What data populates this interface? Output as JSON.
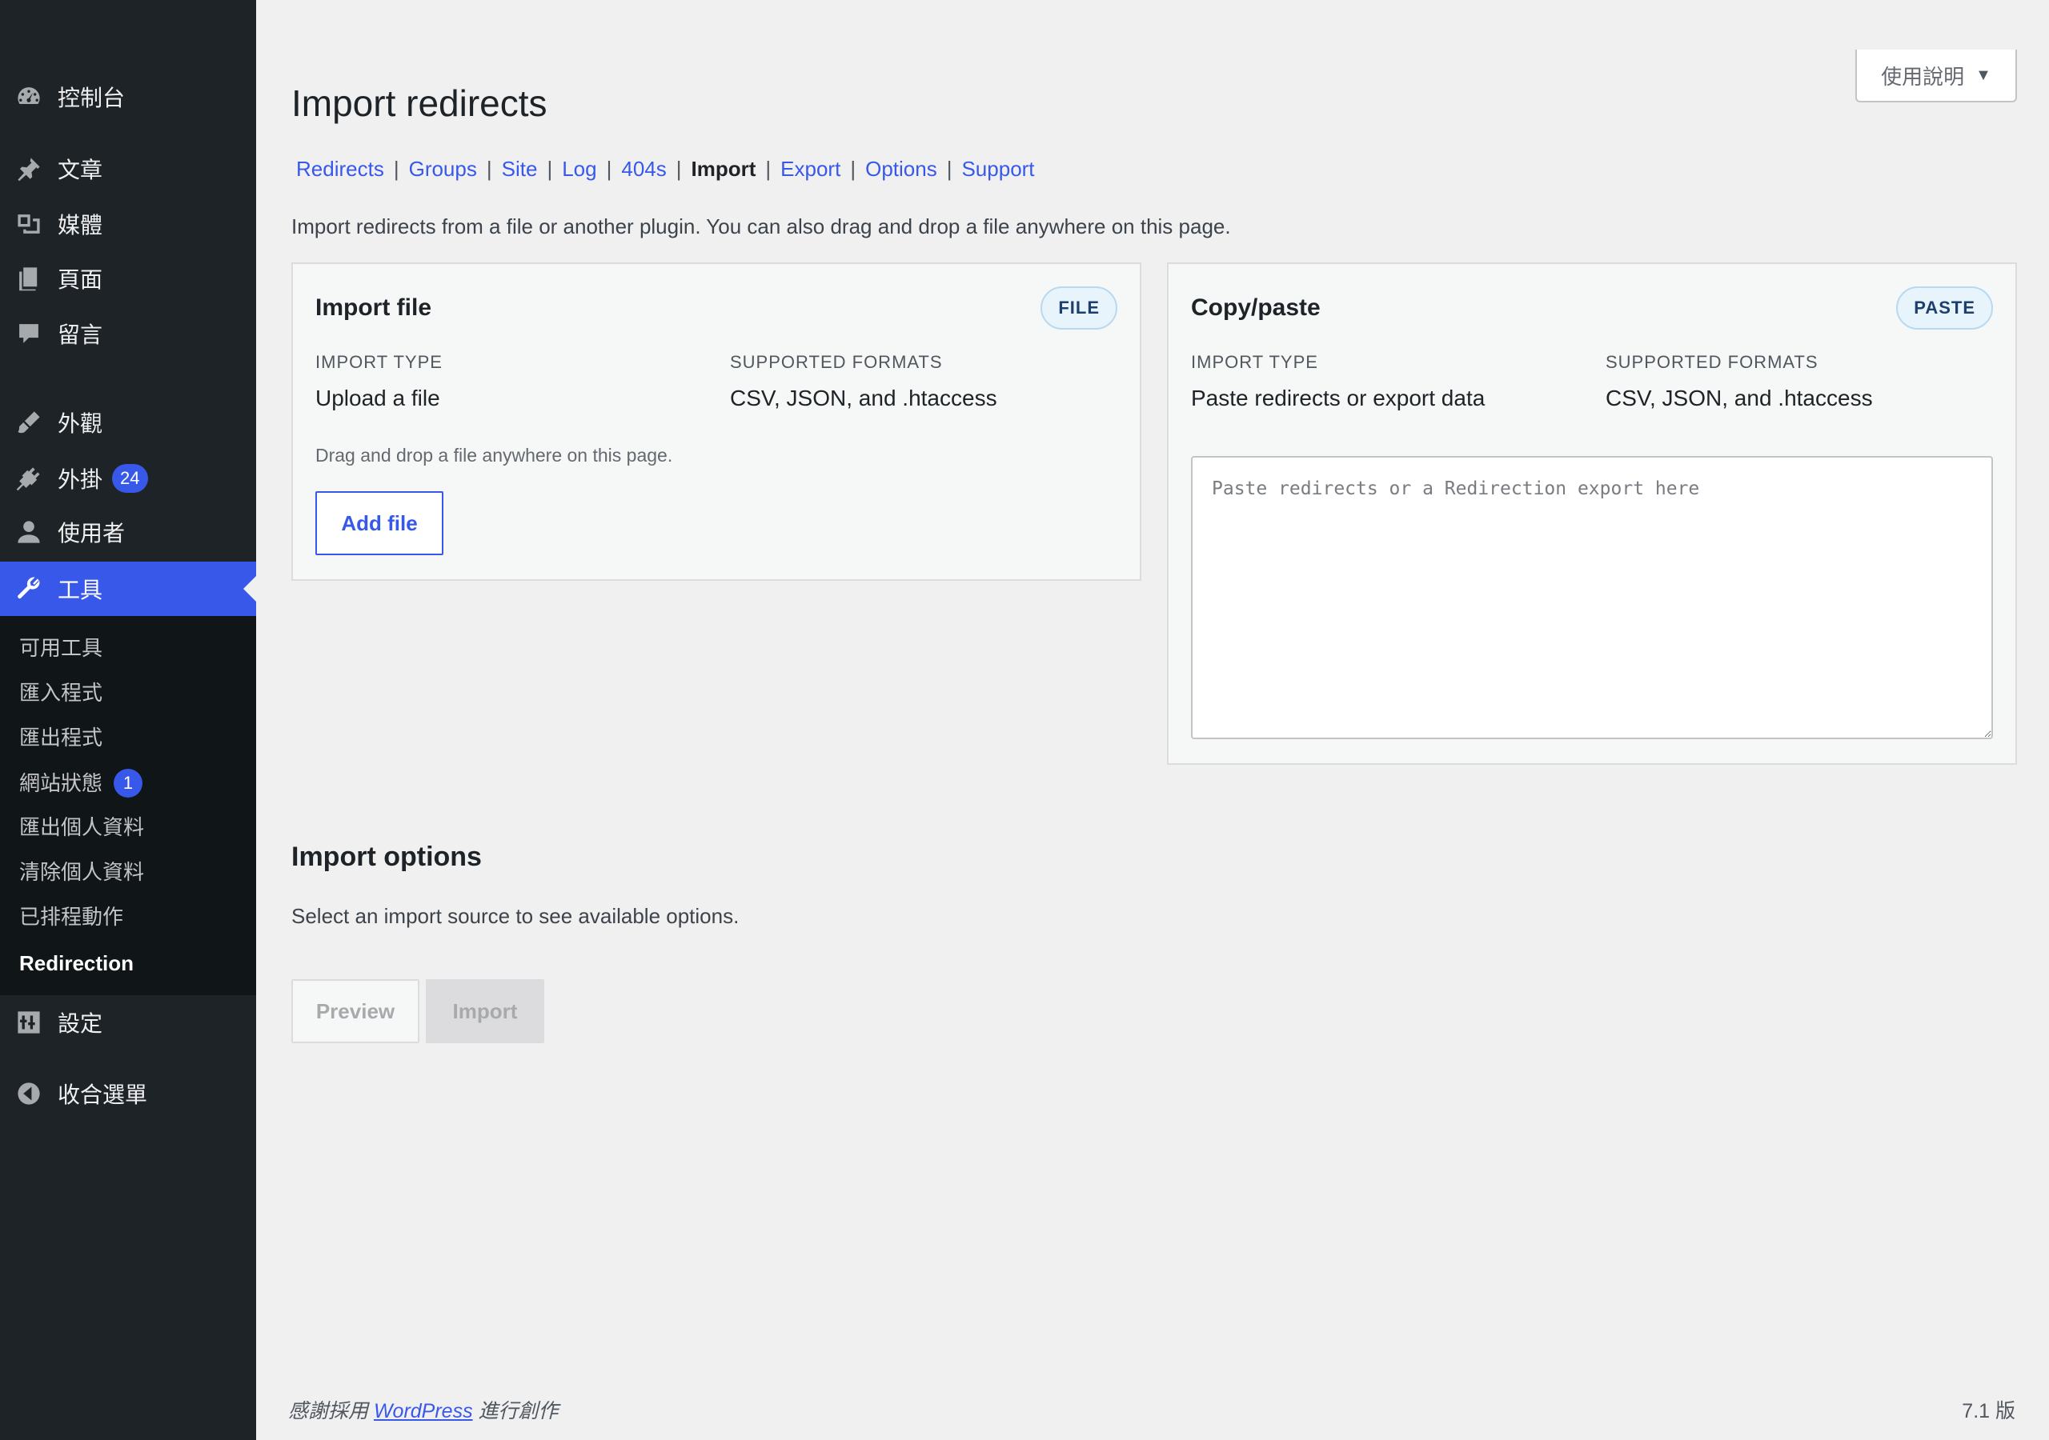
{
  "sidebar": {
    "items": [
      {
        "label": "控制台",
        "icon": "dashboard-icon"
      },
      {
        "label": "文章",
        "icon": "pin-icon"
      },
      {
        "label": "媒體",
        "icon": "media-icon"
      },
      {
        "label": "頁面",
        "icon": "pages-icon"
      },
      {
        "label": "留言",
        "icon": "comment-icon"
      },
      {
        "label": "外觀",
        "icon": "brush-icon"
      },
      {
        "label": "外掛",
        "icon": "plugin-icon",
        "badge": "24"
      },
      {
        "label": "使用者",
        "icon": "user-icon"
      },
      {
        "label": "工具",
        "icon": "wrench-icon"
      },
      {
        "label": "設定",
        "icon": "settings-icon"
      },
      {
        "label": "收合選單",
        "icon": "collapse-icon"
      }
    ],
    "active": "工具",
    "submenu": [
      {
        "label": "可用工具"
      },
      {
        "label": "匯入程式"
      },
      {
        "label": "匯出程式"
      },
      {
        "label": "網站狀態",
        "badge": "1"
      },
      {
        "label": "匯出個人資料"
      },
      {
        "label": "清除個人資料"
      },
      {
        "label": "已排程動作"
      },
      {
        "label": "Redirection"
      }
    ],
    "current_submenu": "Redirection"
  },
  "help_tab": {
    "label": "使用說明",
    "caret": "▼"
  },
  "page": {
    "title": "Import redirects",
    "nav": [
      "Redirects",
      "Groups",
      "Site",
      "Log",
      "404s",
      "Import",
      "Export",
      "Options",
      "Support"
    ],
    "nav_current": "Import",
    "intro": "Import redirects from a file or another plugin. You can also drag and drop a file anywhere on this page."
  },
  "import_file_card": {
    "title": "Import file",
    "badge": "FILE",
    "type_label": "IMPORT TYPE",
    "type_value": "Upload a file",
    "formats_label": "SUPPORTED FORMATS",
    "formats_value": "CSV, JSON, and .htaccess",
    "hint": "Drag and drop a file anywhere on this page.",
    "button": "Add file"
  },
  "paste_card": {
    "title": "Copy/paste",
    "badge": "PASTE",
    "type_label": "IMPORT TYPE",
    "type_value": "Paste redirects or export data",
    "formats_label": "SUPPORTED FORMATS",
    "formats_value": "CSV, JSON, and .htaccess",
    "textarea_placeholder": "Paste redirects or a Redirection export here",
    "textarea_value": ""
  },
  "import_options": {
    "title": "Import options",
    "text": "Select an import source to see available options.",
    "preview_button": "Preview",
    "import_button": "Import"
  },
  "footer": {
    "thanks_prefix": "感謝採用 ",
    "link": "WordPress",
    "thanks_suffix": " 進行創作",
    "version": "7.1 版"
  },
  "colors": {
    "sidebar_bg": "#1d2327",
    "submenu_bg": "#101517",
    "accent": "#3858e9",
    "page_bg": "#f0f0f1"
  }
}
